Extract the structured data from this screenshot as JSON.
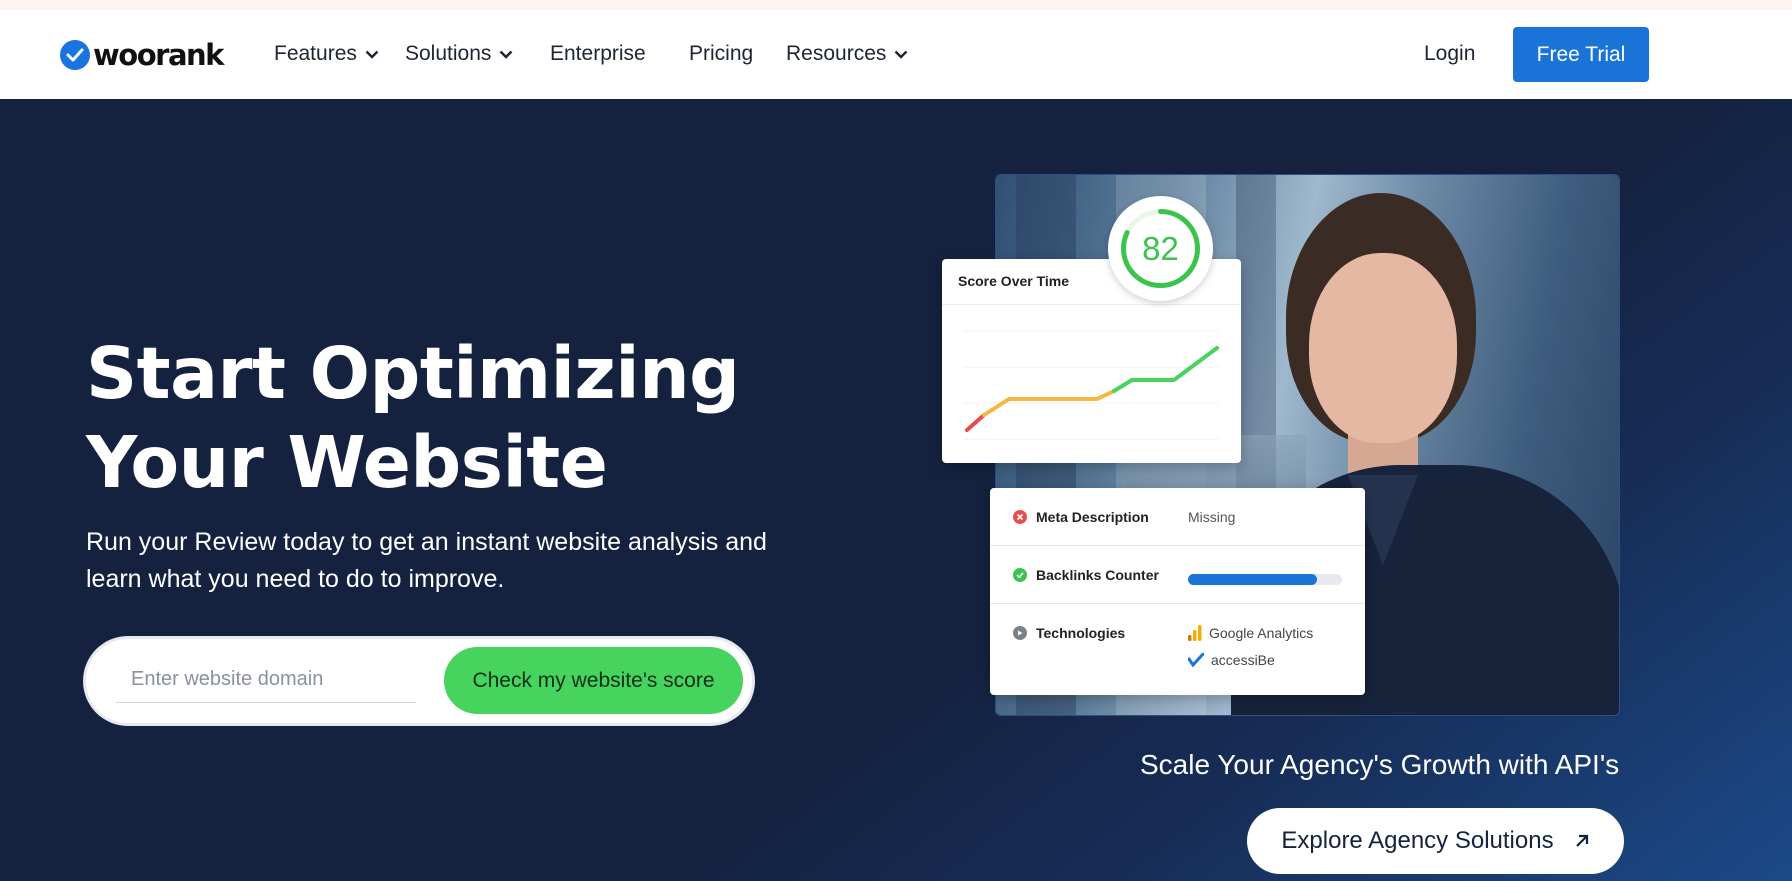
{
  "brand": {
    "name": "woorank",
    "color": "#1a74e0"
  },
  "nav": {
    "items": [
      {
        "label": "Features",
        "dropdown": true
      },
      {
        "label": "Solutions",
        "dropdown": true
      },
      {
        "label": "Enterprise",
        "dropdown": false
      },
      {
        "label": "Pricing",
        "dropdown": false
      },
      {
        "label": "Resources",
        "dropdown": true
      }
    ],
    "login": "Login",
    "cta": "Free Trial"
  },
  "hero": {
    "headline_line1": "Start Optimizing",
    "headline_line2": "Your Website",
    "subline": "Run your Review today to get an instant website analysis and learn what you need to do to improve.",
    "input_placeholder": "Enter website domain",
    "submit_label": "Check my website's score"
  },
  "score_widget": {
    "title": "Score Over Time",
    "score": "82"
  },
  "audit": {
    "rows": [
      {
        "label": "Meta Description",
        "status": "error",
        "value": "Missing"
      },
      {
        "label": "Backlinks Counter",
        "status": "ok",
        "progress": 0.84
      },
      {
        "label": "Technologies",
        "status": "info",
        "items": [
          "Google Analytics",
          "accessiBe"
        ]
      }
    ]
  },
  "agency": {
    "text": "Scale Your Agency's Growth with API's",
    "button": "Explore Agency Solutions"
  },
  "colors": {
    "primary": "#1a74d8",
    "cta_green": "#46d35e",
    "hero_bg": "#14223f",
    "error": "#e84c4c",
    "ok": "#3cc24f",
    "warning": "#f5b83d"
  }
}
